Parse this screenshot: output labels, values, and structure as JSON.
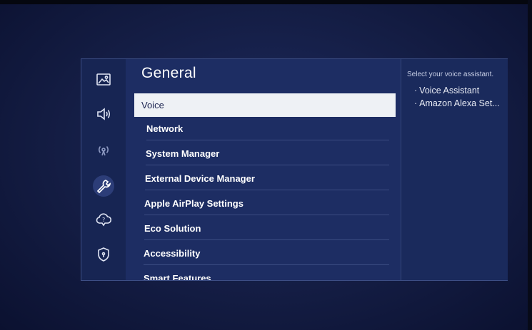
{
  "settings": {
    "title": "General",
    "menu": [
      {
        "label": "Voice"
      },
      {
        "label": "Network"
      },
      {
        "label": "System Manager"
      },
      {
        "label": "External Device Manager"
      },
      {
        "label": "Apple AirPlay Settings"
      },
      {
        "label": "Eco Solution"
      },
      {
        "label": "Accessibility"
      },
      {
        "label": "Smart Features"
      }
    ],
    "selected_index": 0
  },
  "sidebar": {
    "icons": [
      "picture-icon",
      "sound-icon",
      "broadcasting-icon",
      "general-wrench-icon",
      "support-cloud-icon",
      "privacy-shield-icon"
    ],
    "active_icon": "general-wrench-icon"
  },
  "help": {
    "title": "Select your voice assistant.",
    "options": [
      {
        "bullet": "·",
        "label": "Voice Assistant"
      },
      {
        "bullet": "·",
        "label": "Amazon Alexa Set..."
      }
    ]
  },
  "colors": {
    "background": "#141d44",
    "panel": "#1d2d63",
    "selected_row": "#eef1f5",
    "text": "#ffffff"
  }
}
